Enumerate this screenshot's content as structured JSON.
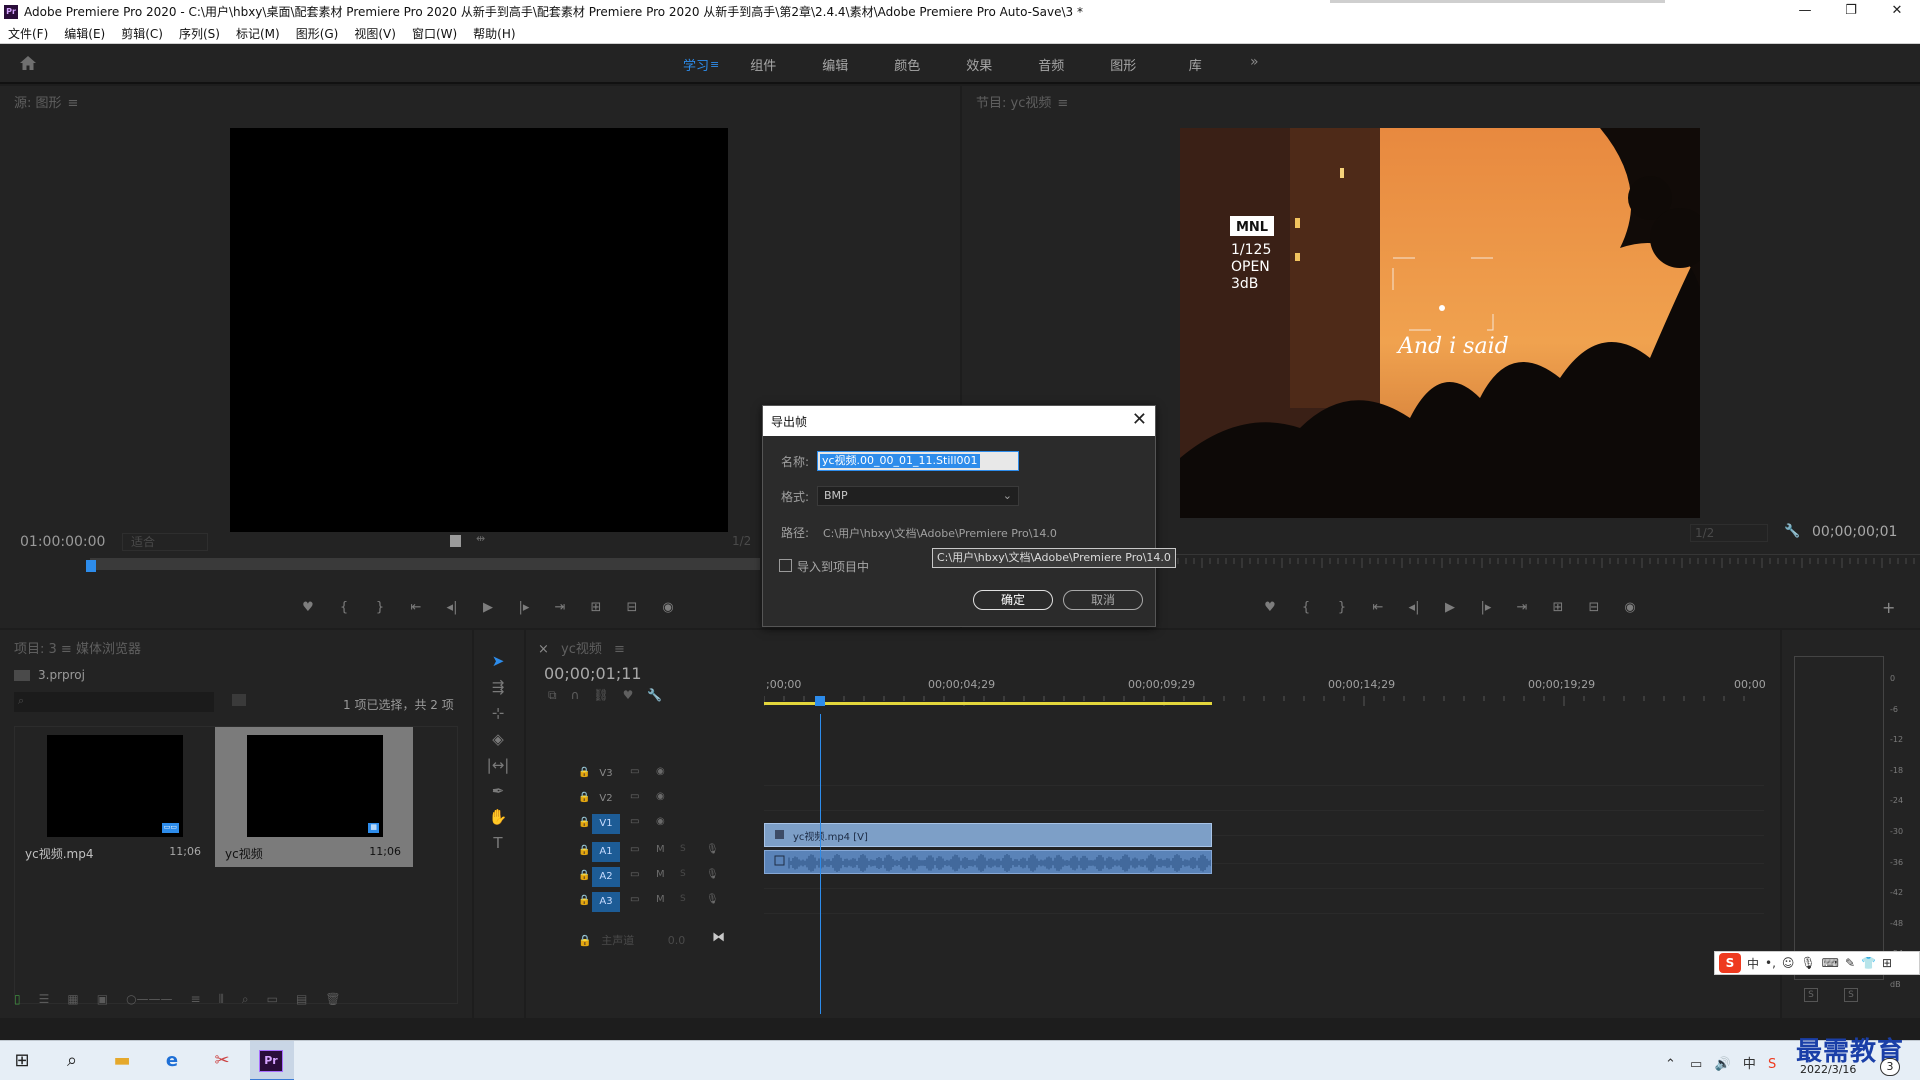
{
  "window": {
    "title": "Adobe Premiere Pro 2020 - C:\\用户\\hbxy\\桌面\\配套素材 Premiere Pro 2020 从新手到高手\\配套素材 Premiere Pro 2020 从新手到高手\\第2章\\2.4.4\\素材\\Adobe Premiere Pro Auto-Save\\3 *",
    "logo": "Pr",
    "min": "—",
    "restore": "❐",
    "close": "✕"
  },
  "menu": [
    "文件(F)",
    "编辑(E)",
    "剪辑(C)",
    "序列(S)",
    "标记(M)",
    "图形(G)",
    "视图(V)",
    "窗口(W)",
    "帮助(H)"
  ],
  "workspaces": {
    "tabs": [
      "学习",
      "组件",
      "编辑",
      "颜色",
      "效果",
      "音频",
      "图形",
      "库"
    ],
    "active": "学习",
    "more": "»"
  },
  "source": {
    "header": "源: 图形",
    "timecode": "01:00:00:00",
    "fit": "适合",
    "resolution": "1/2"
  },
  "program": {
    "header": "节目: yc视频",
    "timecode": "00;00;00;01",
    "resolution": "1/2",
    "overlay": {
      "brand": "MNL",
      "shutter": "1/125",
      "aperture": "OPEN",
      "gain": "3dB",
      "caption": "And i said"
    }
  },
  "transport_icons": [
    "♥",
    "{",
    "}",
    "⇤",
    "◂|",
    "▶",
    "|▸",
    "⇥",
    "⊞",
    "⊟",
    "◉"
  ],
  "project": {
    "tabs": "项目: 3  ≡    媒体浏览器",
    "file": "3.prproj",
    "count": "1 项已选择，共 2 项",
    "items": [
      {
        "name": "yc视频.mp4",
        "duration": "11;06"
      },
      {
        "name": "yc视频",
        "duration": "11;06"
      }
    ]
  },
  "timeline": {
    "tab": "yc视频",
    "timecode": "00;00;01;11",
    "ruler": [
      ";00;00",
      "00;00;04;29",
      "00;00;09;29",
      "00;00;14;29",
      "00;00;19;29",
      "00;00"
    ],
    "video_tracks": [
      "V3",
      "V2",
      "V1"
    ],
    "audio_tracks": [
      "A1",
      "A2",
      "A3"
    ],
    "master": "主声道",
    "master_value": "0.0",
    "video_clip": "yc视频.mp4 [V]"
  },
  "meter": {
    "scale": [
      "0",
      "-6",
      "-12",
      "-18",
      "-24",
      "-30",
      "-36",
      "-42",
      "-48",
      "-54",
      "dB"
    ],
    "solo": [
      "S",
      "S"
    ]
  },
  "dialog": {
    "title": "导出帧",
    "name_label": "名称:",
    "name_value": "yc视频.00_00_01_11.Still001",
    "format_label": "格式:",
    "format_value": "BMP",
    "path_label": "路径:",
    "path_value": "C:\\用户\\hbxy\\文档\\Adobe\\Premiere Pro\\14.0",
    "import_label": "导入到项目中",
    "ok": "确定",
    "cancel": "取消",
    "tooltip": "C:\\用户\\hbxy\\文档\\Adobe\\Premiere Pro\\14.0"
  },
  "ime": {
    "logo": "S",
    "lang": "中",
    "punct": "•,"
  },
  "taskbar": {
    "date": "2022/3/16",
    "notifications": "3",
    "watermark": "最需教育"
  },
  "colors": {
    "accent": "#2d8ceb",
    "work_area": "#e3d63c",
    "video_clip": "#7d9fc7",
    "audio_clip": "#5a83b8"
  }
}
